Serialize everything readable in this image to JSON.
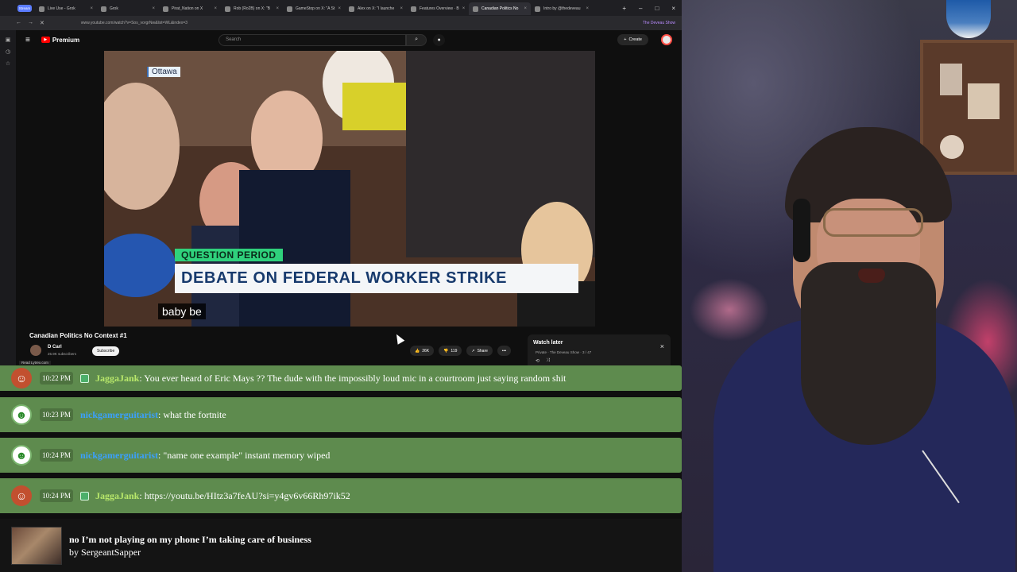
{
  "browser": {
    "tabs": [
      {
        "label": "Live Use - Grok",
        "active": false
      },
      {
        "label": "Grok",
        "active": false
      },
      {
        "label": "Pirat_Nation on X",
        "active": false
      },
      {
        "label": "Rob (Ro2B) on X: \"B",
        "active": false
      },
      {
        "label": "GameStop on X: \"A St",
        "active": false
      },
      {
        "label": "Alex on X: \"I launche",
        "active": false
      },
      {
        "label": "Features Overview · B",
        "active": false
      },
      {
        "label": "Canadian Politics No",
        "active": true
      },
      {
        "label": "Intro by @thedeveau",
        "active": false
      }
    ],
    "stream_pill": "Stream",
    "url": "www.youtube.com/watch?v=Sos_vorgrNw&list=WL&index=3",
    "profile": "The Deveau Show"
  },
  "youtube": {
    "logo": "Premium",
    "search_placeholder": "Search",
    "create_label": "Create"
  },
  "video": {
    "location_chip": "Ottawa",
    "lower_third_tag": "QUESTION PERIOD",
    "lower_third_headline": "DEBATE ON FEDERAL WORKER STRIKE",
    "caption": "baby be"
  },
  "meta": {
    "title": "Canadian Politics No Context #1",
    "channel": "D Carl",
    "subscribers": "25.9K subscribers",
    "subscribe_label": "Subscribe",
    "likes": "26K",
    "dislikes": "119",
    "share_label": "Share",
    "read_url": "Read Lytrex.com"
  },
  "watch_later": {
    "title": "Watch later",
    "subtitle": "Private · The Deveau Show · 3 / 47"
  },
  "chat": [
    {
      "time": "10:22 PM",
      "user": "JaggaJank",
      "kind": "jagga",
      "text": ": You ever heard of Eric Mays ?? The dude with the impossibly loud mic in a courtroom just saying random shit"
    },
    {
      "time": "10:23 PM",
      "user": "nickgamerguitarist",
      "kind": "nick",
      "text": ": what the fortnite"
    },
    {
      "time": "10:24 PM",
      "user": "nickgamerguitarist",
      "kind": "nick",
      "text": ": \"name one example\" instant memory wiped"
    },
    {
      "time": "10:24 PM",
      "user": "JaggaJank",
      "kind": "jagga",
      "text": ": https://youtu.be/HItz3a7feAU?si=y4gv6v66Rh97ik52"
    }
  ],
  "now_playing": {
    "title": "no I’m not playing on my phone I’m taking care of business",
    "by": "by SergeantSapper"
  }
}
